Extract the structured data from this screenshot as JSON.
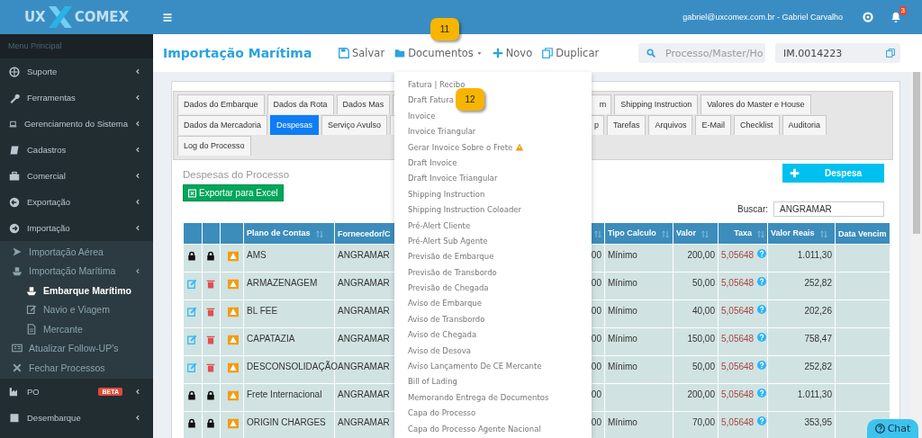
{
  "logo": {
    "left": "UX",
    "right": "COMEX"
  },
  "sidebar": {
    "heading": "Menu Principal",
    "items": [
      {
        "label": "Suporte",
        "selected": false
      },
      {
        "label": "Ferramentas",
        "selected": false
      },
      {
        "label": "Gerenciamento do Sistema",
        "selected": false
      },
      {
        "label": "Cadastros",
        "selected": false
      },
      {
        "label": "Comercial",
        "selected": false
      },
      {
        "label": "Exportação",
        "selected": false
      },
      {
        "label": "Importação",
        "selected": false,
        "children": [
          {
            "label": "Importação Aérea",
            "selected": false
          },
          {
            "label": "Importação Marítima",
            "selected": false,
            "children": [
              {
                "label": "Embarque Marítimo",
                "selected": true
              },
              {
                "label": "Navio e Viagem",
                "selected": false
              },
              {
                "label": "Mercante",
                "selected": false
              }
            ]
          },
          {
            "label": "Atualizar Follow-UP's",
            "selected": false
          },
          {
            "label": "Fechar Processos",
            "selected": false
          }
        ]
      },
      {
        "label": "PO",
        "selected": false,
        "badge": "BETA"
      },
      {
        "label": "Desembarque",
        "selected": false
      }
    ]
  },
  "topbar": {
    "user": "gabriel@uxcomex.com.br - Gabriel Carvalho",
    "notifications": "3"
  },
  "page": {
    "title": "Importação Marítima",
    "toolbar": [
      {
        "label": "Salvar"
      },
      {
        "label": "Documentos"
      },
      {
        "label": "Novo"
      },
      {
        "label": "Duplicar"
      }
    ],
    "search": {
      "placeholder": "Processo/Master/Ho"
    },
    "process": {
      "value": "IM.0014223"
    }
  },
  "tab_rows": [
    [
      {
        "label": "Dados do Embarque",
        "selected": false
      },
      {
        "label": "Dados da Rota",
        "selected": false
      },
      {
        "label": "Dados Mas",
        "selected": false
      },
      {
        "label": "m",
        "selected": false,
        "kind": "cut"
      },
      {
        "label": "Shipping Instruction",
        "selected": false
      },
      {
        "label": "Valores do Master e House",
        "selected": false
      }
    ],
    [
      {
        "label": "Dados da Mercadoria",
        "selected": false
      },
      {
        "label": "Despesas",
        "selected": true
      },
      {
        "label": "Serviço Avulso",
        "selected": false
      },
      {
        "label": "p",
        "selected": false,
        "kind": "cut"
      },
      {
        "label": "Tarefas",
        "selected": false
      },
      {
        "label": "Arquivos",
        "selected": false
      },
      {
        "label": "E-Mail",
        "selected": false
      },
      {
        "label": "Checklist",
        "selected": false
      },
      {
        "label": "Auditoria",
        "selected": false
      }
    ],
    [
      {
        "label": "Log do Processo",
        "selected": false
      }
    ]
  ],
  "expenses": {
    "title": "Despesas do Processo",
    "export_button": "Exportar para Excel",
    "add_button": "Despesa",
    "search_label": "Buscar:",
    "search_value": "ANGRAMAR",
    "columns": [
      "Plano de Contas",
      "Fornecedor/C",
      "",
      "Tipo Calculo",
      "Valor",
      "Taxa",
      "Valor Reais",
      "Data Vencim"
    ],
    "rows": [
      {
        "locked": true,
        "account": "AMS",
        "supplier": "ANGRAMAR",
        "column_6": ",00",
        "calc": "Mínimo",
        "value": "200,00",
        "rate": "5,05648",
        "reais": "1.011,30"
      },
      {
        "locked": false,
        "account": "ARMAZENAGEM",
        "supplier": "ANGRAMAR",
        "column_6": ",00",
        "calc": "Mínimo",
        "value": "50,00",
        "rate": "5,05648",
        "reais": "252,82"
      },
      {
        "locked": false,
        "account": "BL FEE",
        "supplier": "ANGRAMAR",
        "column_6": ",00",
        "calc": "Mínimo",
        "value": "40,00",
        "rate": "5,05648",
        "reais": "202,26"
      },
      {
        "locked": false,
        "account": "CAPATAZIA",
        "supplier": "ANGRAMAR",
        "column_6": ",00",
        "calc": "Mínimo",
        "value": "150,00",
        "rate": "5,05648",
        "reais": "758,47"
      },
      {
        "locked": false,
        "account": "DESCONSOLIDAÇÃO",
        "supplier": "ANGRAMAR",
        "column_6": ",00",
        "calc": "Mínimo",
        "value": "50,00",
        "rate": "5,05648",
        "reais": "252,82"
      },
      {
        "locked": true,
        "account": "Frete Internacional",
        "supplier": "ANGRAMAR",
        "column_6": ",00",
        "calc": "",
        "value": "200,00",
        "rate": "5,05648",
        "reais": "1.011,30"
      },
      {
        "locked": true,
        "account": "ORIGIN CHARGES",
        "supplier": "ANGRAMAR",
        "column_6": ",00",
        "calc": "Mínimo",
        "value": "70,00",
        "rate": "5,05648",
        "reais": "353,95"
      }
    ]
  },
  "documents_menu": [
    {
      "label": "Fatura | Recibo",
      "warning": false
    },
    {
      "label": "Draft Fatura",
      "warning": false
    },
    {
      "label": "Invoice",
      "warning": false
    },
    {
      "label": "Invoice Triangular",
      "warning": false
    },
    {
      "label": "Gerar Invoice Sobre o Frete",
      "warning": true
    },
    {
      "label": "Draft Invoice",
      "warning": false
    },
    {
      "label": "Draft Invoice Triangular",
      "warning": false
    },
    {
      "label": "Shipping Instruction",
      "warning": false
    },
    {
      "label": "Shipping Instruction Coloader",
      "warning": false
    },
    {
      "label": "Pré-Alert Cliente",
      "warning": false
    },
    {
      "label": "Pré-Alert Sub Agente",
      "warning": false
    },
    {
      "label": "Previsão de Embarque",
      "warning": false
    },
    {
      "label": "Previsão de Transbordo",
      "warning": false
    },
    {
      "label": "Previsão de Chegada",
      "warning": false
    },
    {
      "label": "Aviso de Embarque",
      "warning": false
    },
    {
      "label": "Aviso de Transbordo",
      "warning": false
    },
    {
      "label": "Aviso de Chegada",
      "warning": false
    },
    {
      "label": "Aviso de Desova",
      "warning": false
    },
    {
      "label": "Aviso Lançamento De CE Mercante",
      "warning": false
    },
    {
      "label": "Bill of Lading",
      "warning": false
    },
    {
      "label": "Memorando Entrega de Documentos",
      "warning": false
    },
    {
      "label": "Capa do Processo",
      "warning": false
    },
    {
      "label": "Capa do Processo Agente Nacional",
      "warning": false
    }
  ],
  "step_markers": [
    {
      "text": "11"
    },
    {
      "text": "12"
    }
  ],
  "chat": {
    "label": "Chat"
  }
}
